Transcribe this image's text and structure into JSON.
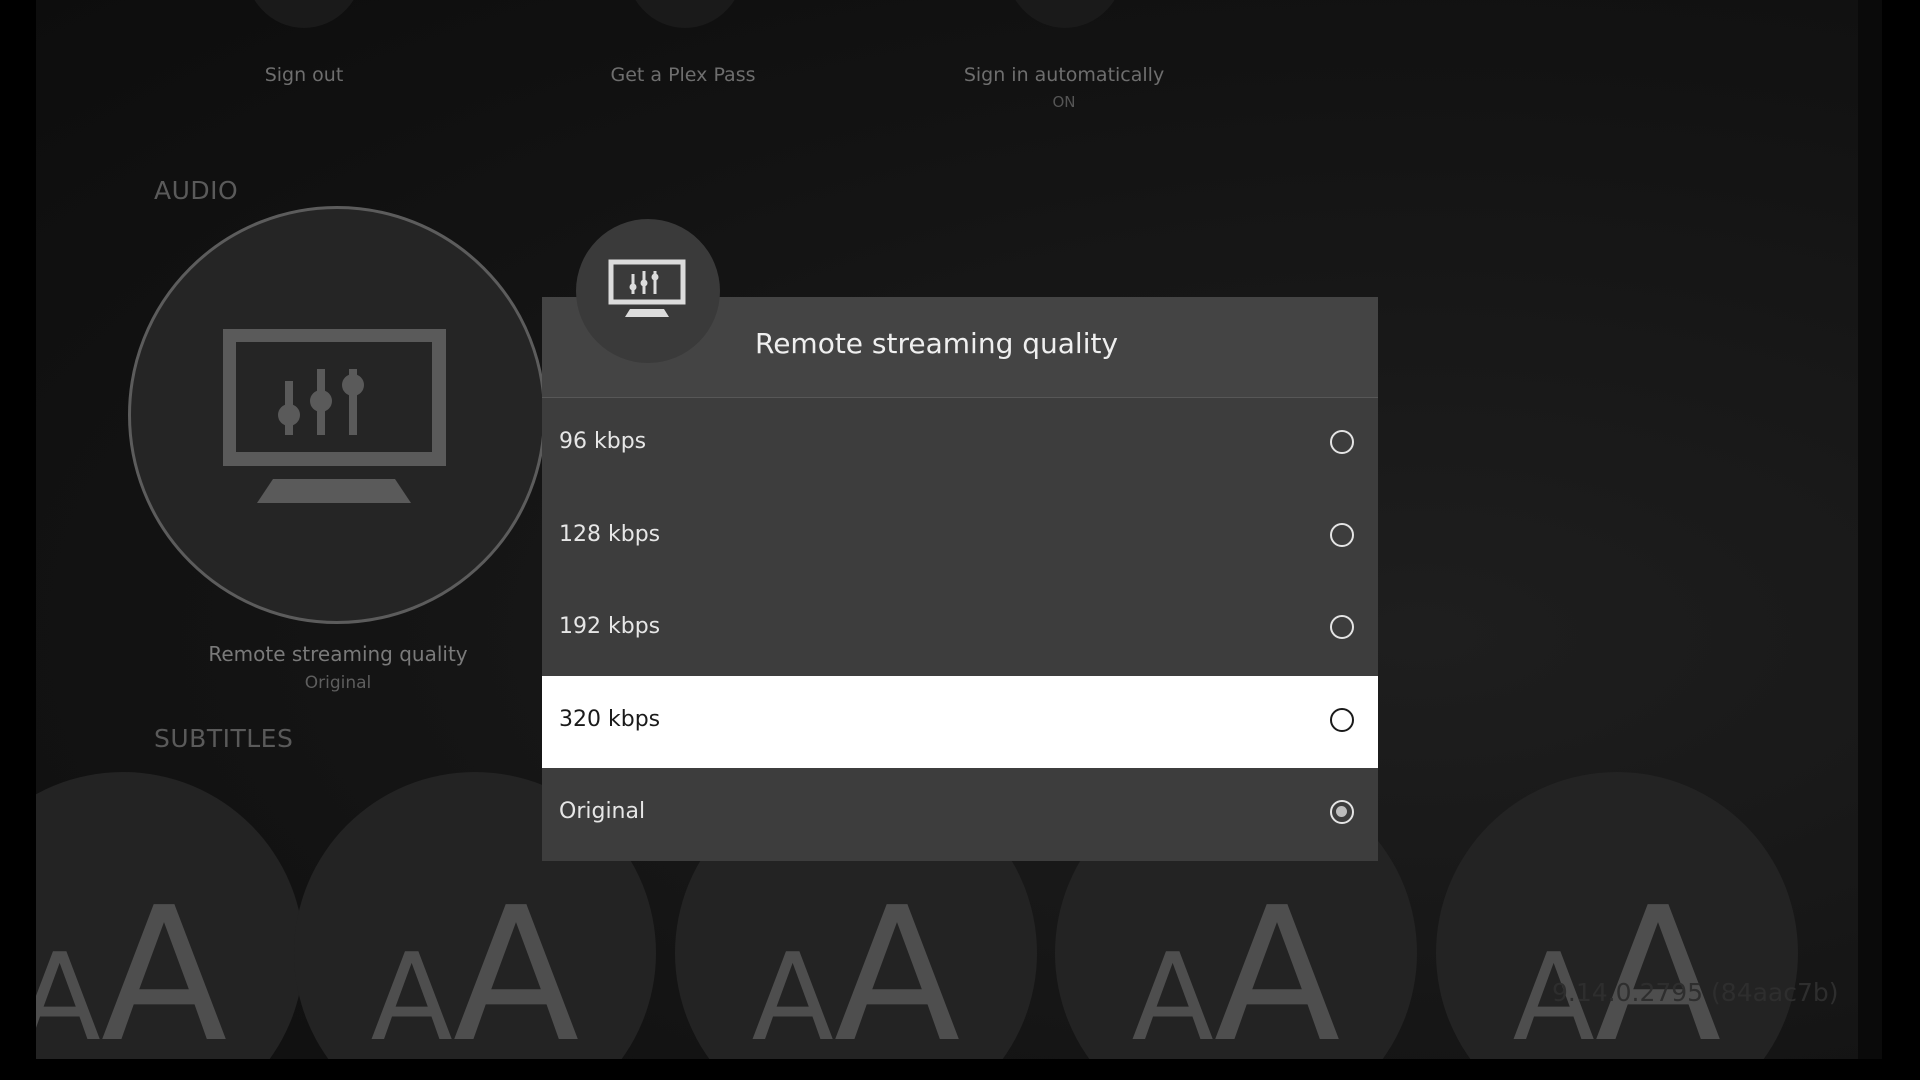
{
  "account_row": {
    "items": [
      {
        "label": "Sign out",
        "sub": ""
      },
      {
        "label": "Get a Plex Pass",
        "sub": ""
      },
      {
        "label": "Sign in automatically",
        "sub": "ON"
      }
    ]
  },
  "audio_section": {
    "header": "AUDIO",
    "item": {
      "label": "Remote streaming quality",
      "value": "Original",
      "icon": "monitor-equalizer-icon"
    }
  },
  "subtitles_section": {
    "header": "SUBTITLES",
    "tile_glyph_small": "A",
    "tile_glyph_large": "A"
  },
  "version_text": "9.14.0.2795 (84aac7b)",
  "dialog": {
    "title": "Remote streaming quality",
    "icon": "monitor-equalizer-icon",
    "options": [
      {
        "label": "96 kbps",
        "selected": false,
        "focused": false
      },
      {
        "label": "128 kbps",
        "selected": false,
        "focused": false
      },
      {
        "label": "192 kbps",
        "selected": false,
        "focused": false
      },
      {
        "label": "320 kbps",
        "selected": false,
        "focused": true
      },
      {
        "label": "Original",
        "selected": true,
        "focused": false
      }
    ]
  },
  "colors": {
    "background": "#000000",
    "dialog_bg": "#3d3d3d",
    "dialog_header_bg": "#444444",
    "focus_bg": "#ffffff",
    "text_light": "#efefef"
  }
}
